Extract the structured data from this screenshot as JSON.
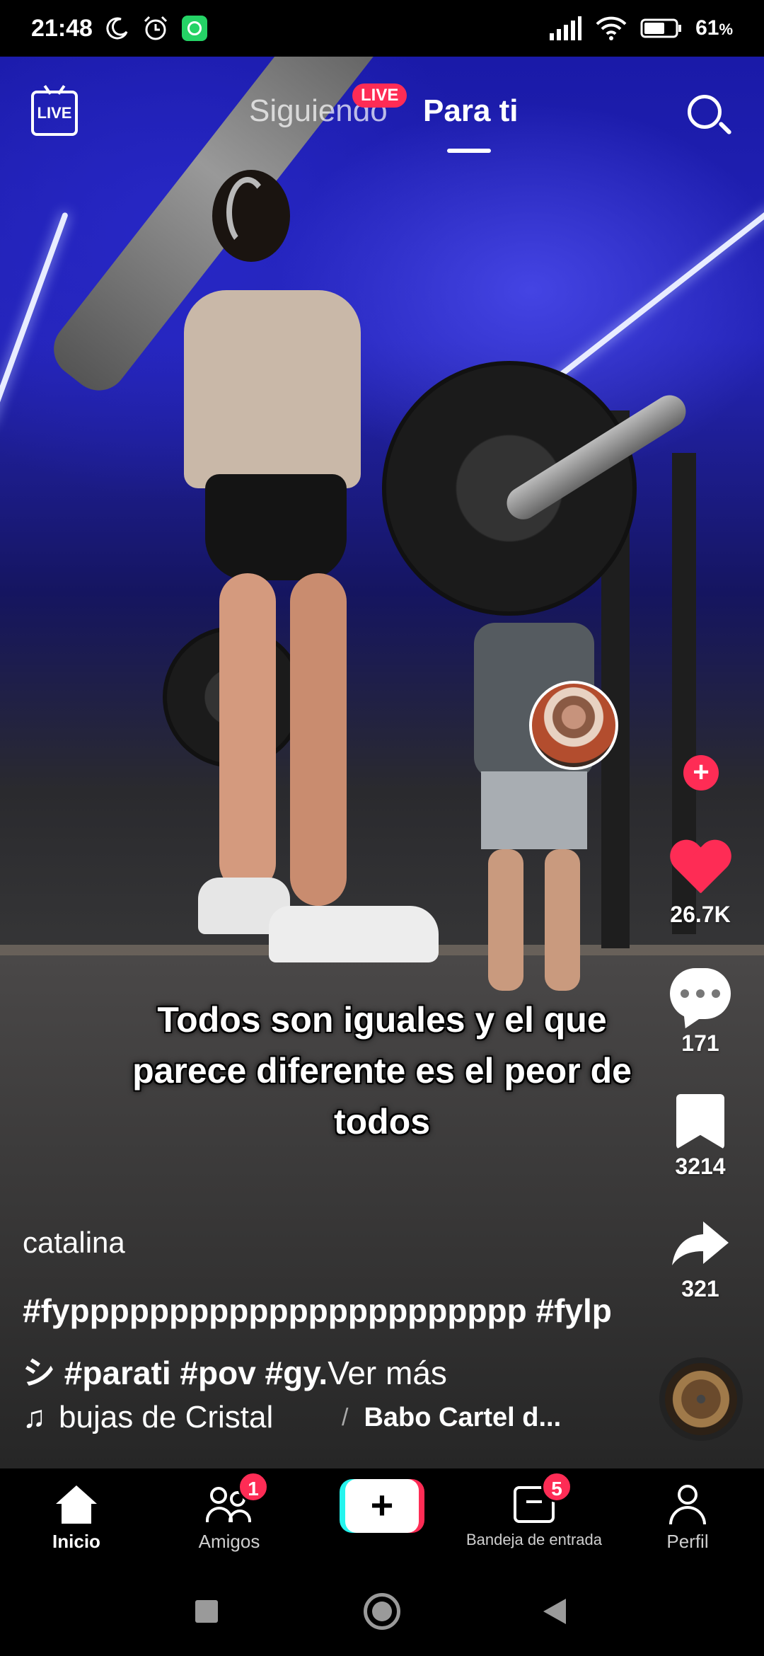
{
  "status_bar": {
    "time": "21:48",
    "battery": "61",
    "battery_unit": "%"
  },
  "top_nav": {
    "live_icon_label": "LIVE",
    "tabs": [
      {
        "label": "Siguiendo",
        "active": false
      },
      {
        "label": "Para ti",
        "active": true
      }
    ],
    "live_badge": "LIVE"
  },
  "video": {
    "overlay_caption": "Todos son iguales y el que parece diferente es el peor de todos",
    "author": "catalina",
    "hashtags": "#fyppppppppppppppppppppppp #fylpシ #parati #pov #gy.",
    "more_label": "Ver más",
    "song": "bujas de Cristal",
    "artist": "Babo Cartel d..."
  },
  "actions": {
    "likes": "26.7K",
    "comments": "171",
    "saves": "3214",
    "shares": "321"
  },
  "bottom_nav": {
    "items": [
      {
        "label": "Inicio",
        "active": true
      },
      {
        "label": "Amigos",
        "badge": "1"
      },
      {
        "label": "Bandeja de entrada",
        "badge": "5"
      },
      {
        "label": "Perfil"
      }
    ],
    "create_label": "+"
  },
  "colors": {
    "accent": "#fe2c55",
    "cyan": "#25f4ee",
    "whatsapp": "#25d366"
  }
}
